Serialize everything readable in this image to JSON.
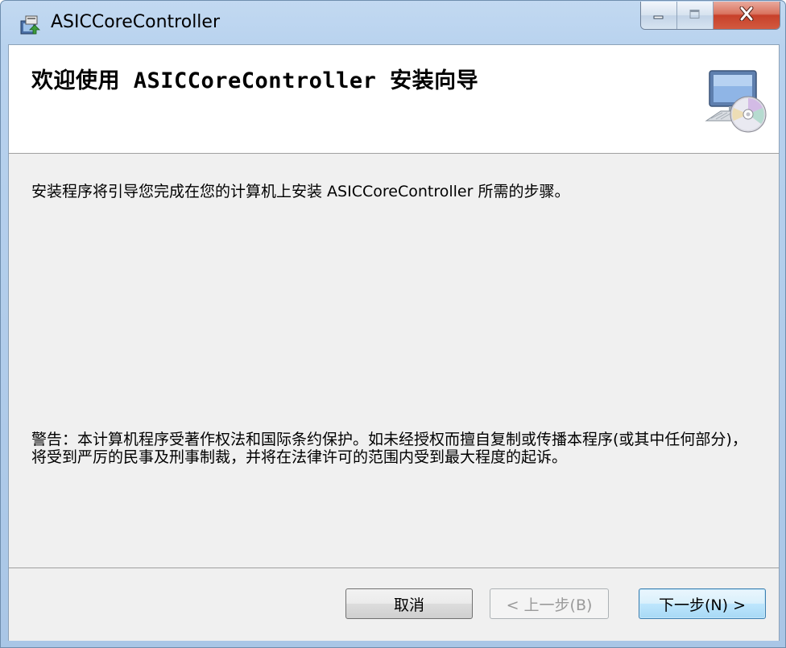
{
  "window": {
    "title": "ASICCoreController",
    "icon": "installer-package-icon",
    "controls": [
      "minimize-icon",
      "maximize-icon",
      "close-icon"
    ]
  },
  "banner": {
    "title": "欢迎使用 ASICCoreController 安装向导",
    "icon": "computer-disc-icon"
  },
  "body": {
    "intro": "安装程序将引导您完成在您的计算机上安装 ASICCoreController 所需的步骤。",
    "warning": "警告：本计算机程序受著作权法和国际条约保护。如未经授权而擅自复制或传播本程序(或其中任何部分)，将受到严厉的民事及刑事制裁，并将在法律许可的范围内受到最大程度的起诉。"
  },
  "footer": {
    "cancel_label": "取消",
    "back_label": "< 上一步(B)",
    "next_label": "下一步(N) >"
  },
  "colors": {
    "title_bar": "#b8d2ee",
    "close_button": "#c7402a",
    "dialog_body": "#f0f0f0",
    "banner": "#ffffff",
    "default_button_border": "#3c7fb1"
  }
}
